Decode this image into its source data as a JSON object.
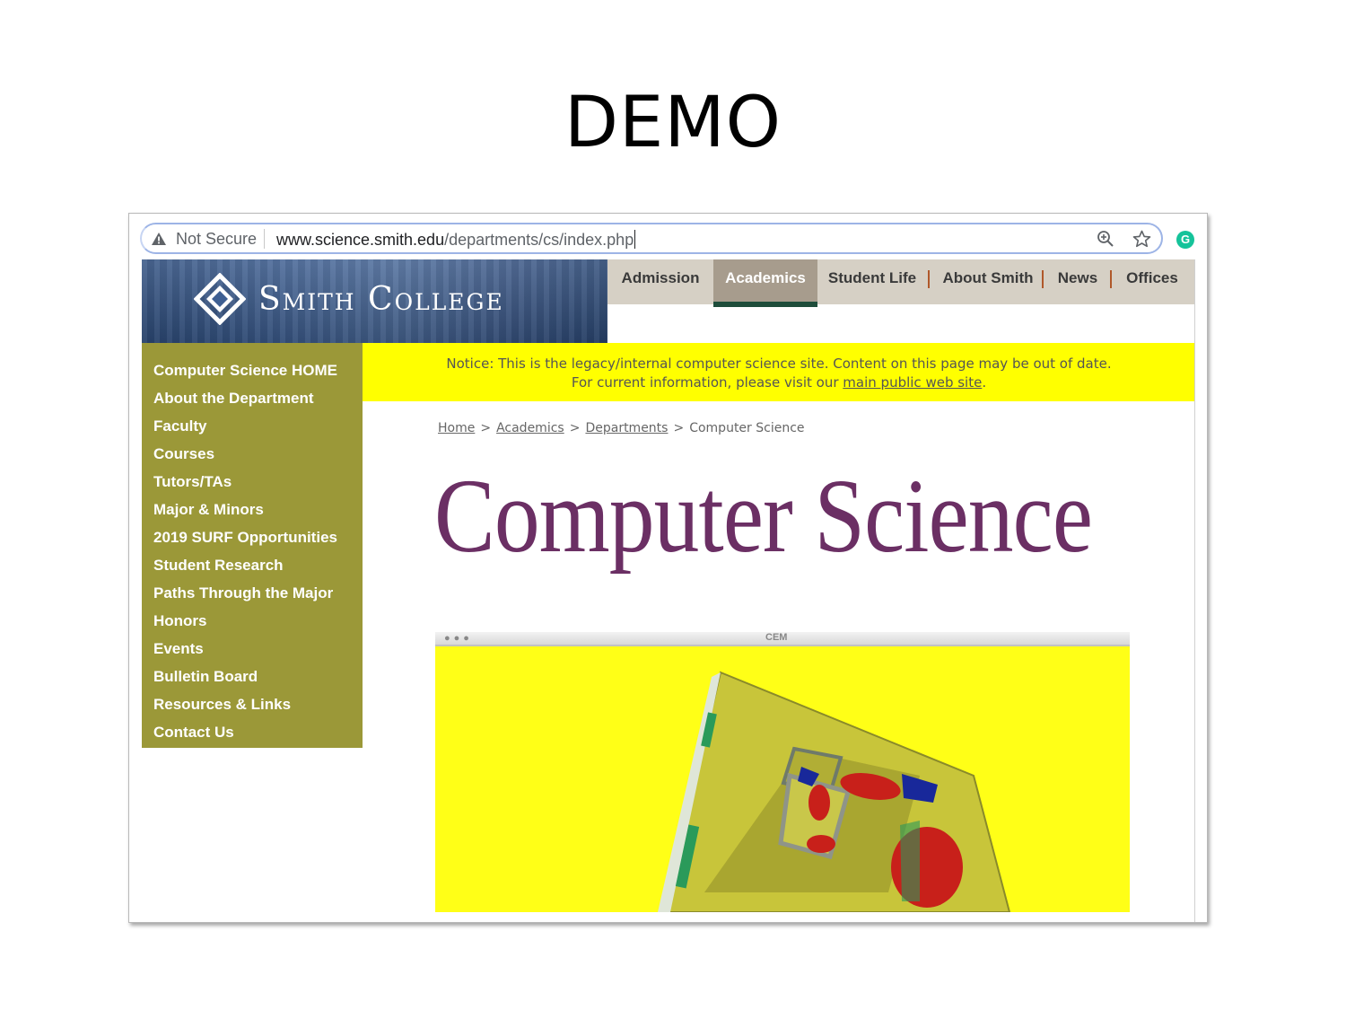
{
  "slide": {
    "title": "DEMO"
  },
  "browser": {
    "security_label": "Not Secure",
    "url_host": "www.science.smith.edu",
    "url_path": "/departments/cs/index.php",
    "extension_letter": "G"
  },
  "site": {
    "logo_text": "Smith College",
    "top_nav": [
      {
        "label": "Admission",
        "active": false
      },
      {
        "label": "Academics",
        "active": true
      },
      {
        "label": "Student Life",
        "active": false
      },
      {
        "label": "About Smith",
        "active": false
      },
      {
        "label": "News",
        "active": false
      },
      {
        "label": "Offices",
        "active": false
      }
    ],
    "sidebar": [
      "Computer Science HOME",
      "About the Department",
      "Faculty",
      "Courses",
      "Tutors/TAs",
      "Major & Minors",
      "2019 SURF Opportunities",
      "Student Research",
      "Paths Through the Major",
      "Honors",
      "Events",
      "Bulletin Board",
      "Resources & Links",
      "Contact Us"
    ],
    "notice": {
      "line1": "Notice: This is the legacy/internal computer science site. Content on this page may be out of date.",
      "line2_prefix": "For current information, please visit our ",
      "line2_link": "main public web site",
      "line2_suffix": "."
    },
    "breadcrumb": {
      "home": "Home",
      "academics": "Academics",
      "departments": "Departments",
      "current": "Computer Science",
      "separator": ">"
    },
    "page_title": "Computer Science",
    "feature_image": {
      "window_label": "CEM",
      "background_color": "#ffff17"
    },
    "colors": {
      "sidebar": "#9b9838",
      "notice": "#ffff00",
      "title": "#6b2f64",
      "nav_active": "#a79c8d",
      "nav_underline": "#1e4d3b"
    }
  }
}
